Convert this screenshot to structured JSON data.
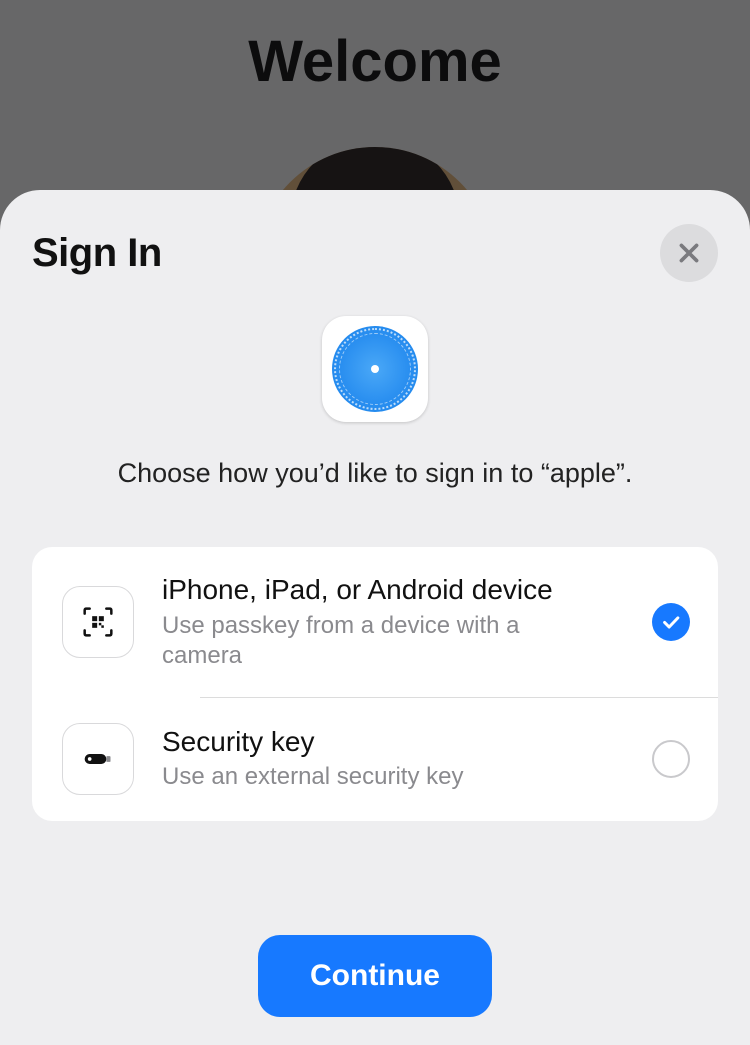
{
  "background": {
    "title": "Welcome"
  },
  "sheet": {
    "title": "Sign In",
    "prompt": "Choose how you’d like to sign in to “apple”.",
    "options": [
      {
        "title": "iPhone, iPad, or Android device",
        "subtitle": "Use passkey from a device with a camera",
        "selected": true
      },
      {
        "title": "Security key",
        "subtitle": "Use an external security key",
        "selected": false
      }
    ],
    "continue_label": "Continue"
  }
}
